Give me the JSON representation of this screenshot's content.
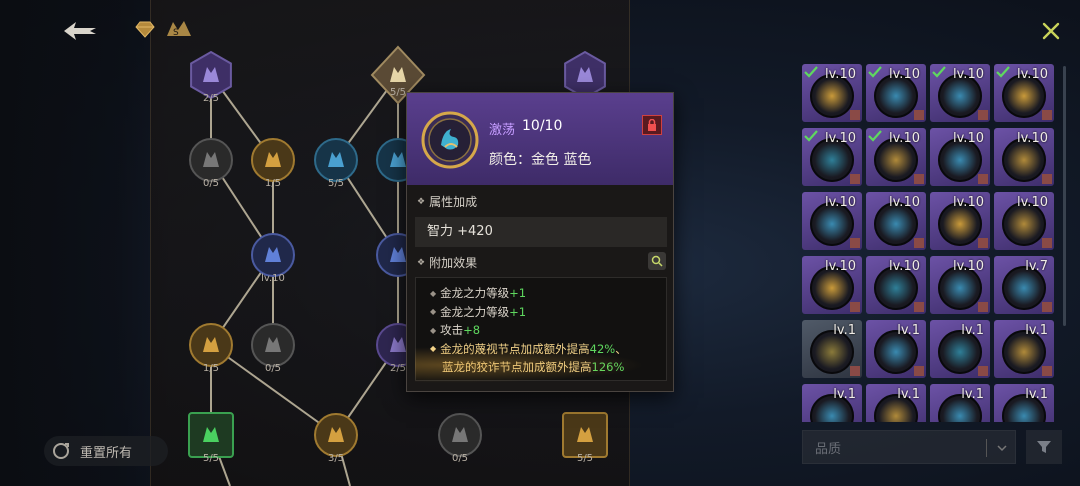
{
  "header": {
    "back_icon": "back-arrow-icon",
    "currency_icon": "gem-icon",
    "rank_icon": "rank-badge-icon",
    "close_icon": "close-icon"
  },
  "tree": {
    "nodes": [
      {
        "label": "2/5"
      },
      {
        "label": "5/5"
      },
      {
        "label": ""
      },
      {
        "label": "0/5"
      },
      {
        "label": "1/5"
      },
      {
        "label": "5/5"
      },
      {
        "label": ""
      },
      {
        "label": "lv.10"
      },
      {
        "label": ""
      },
      {
        "label": "1/5"
      },
      {
        "label": "0/5"
      },
      {
        "label": "2/5"
      },
      {
        "label": "5/5"
      },
      {
        "label": "3/5"
      },
      {
        "label": "0/5"
      },
      {
        "label": "5/5"
      }
    ]
  },
  "reset": {
    "label": "重置所有"
  },
  "tooltip": {
    "name": "激荡",
    "level": "10/10",
    "color_line": "颜色：金色 蓝色",
    "attr_title": "属性加成",
    "stat": "智力 +420",
    "effects_title": "附加效果",
    "effects": [
      {
        "text": "金龙之力等级",
        "value": "+1"
      },
      {
        "text": "金龙之力等级",
        "value": "+1"
      },
      {
        "text": "攻击",
        "value": "+8"
      }
    ],
    "special_line1_prefix": "金龙的蔑视节点加成额外提高",
    "special_line1_value": "42%",
    "special_line1_suffix": "、",
    "special_line2_prefix": "蓝龙的狡诈节点加成额外提高",
    "special_line2_value": "126%"
  },
  "inventory": {
    "slots": [
      {
        "lvl": "lv.10",
        "frame": "purple",
        "check": true,
        "orb": "#c99a3a"
      },
      {
        "lvl": "lv.10",
        "frame": "purple",
        "check": true,
        "orb": "#3a8ab0"
      },
      {
        "lvl": "lv.10",
        "frame": "purple",
        "check": true,
        "orb": "#3a8ab0"
      },
      {
        "lvl": "lv.10",
        "frame": "purple",
        "check": true,
        "orb": "#c99a3a"
      },
      {
        "lvl": "lv.10",
        "frame": "purple",
        "check": true,
        "orb": "#2f7f98"
      },
      {
        "lvl": "lv.10",
        "frame": "purple",
        "check": true,
        "orb": "#b08a3a"
      },
      {
        "lvl": "lv.10",
        "frame": "purple",
        "check": false,
        "orb": "#3a8ab0"
      },
      {
        "lvl": "lv.10",
        "frame": "purple",
        "check": false,
        "orb": "#b08a3a"
      },
      {
        "lvl": "lv.10",
        "frame": "purple",
        "check": false,
        "orb": "#3a8ab0"
      },
      {
        "lvl": "lv.10",
        "frame": "purple",
        "check": false,
        "orb": "#3a8ab0"
      },
      {
        "lvl": "lv.10",
        "frame": "purple",
        "check": false,
        "orb": "#c99a3a"
      },
      {
        "lvl": "lv.10",
        "frame": "purple",
        "check": false,
        "orb": "#b08a3a"
      },
      {
        "lvl": "lv.10",
        "frame": "purple",
        "check": false,
        "orb": "#c99a3a"
      },
      {
        "lvl": "lv.10",
        "frame": "purple",
        "check": false,
        "orb": "#2f7f98"
      },
      {
        "lvl": "lv.10",
        "frame": "purple",
        "check": false,
        "orb": "#3a8ab0"
      },
      {
        "lvl": "lv.7",
        "frame": "purple",
        "check": false,
        "orb": "#3a8ab0"
      },
      {
        "lvl": "lv.1",
        "frame": "gray",
        "check": false,
        "orb": "#8a7a3a"
      },
      {
        "lvl": "lv.1",
        "frame": "purple",
        "check": false,
        "orb": "#3a8ab0"
      },
      {
        "lvl": "lv.1",
        "frame": "purple",
        "check": false,
        "orb": "#2f7f98"
      },
      {
        "lvl": "lv.1",
        "frame": "purple",
        "check": false,
        "orb": "#b08a3a"
      },
      {
        "lvl": "lv.1",
        "frame": "purple",
        "check": false,
        "orb": "#3a8ab0"
      },
      {
        "lvl": "lv.1",
        "frame": "purple",
        "check": false,
        "orb": "#b08a3a"
      },
      {
        "lvl": "lv.1",
        "frame": "purple",
        "check": false,
        "orb": "#3a8ab0"
      },
      {
        "lvl": "lv.1",
        "frame": "purple",
        "check": false,
        "orb": "#3a8ab0"
      }
    ]
  },
  "filter": {
    "quality_placeholder": "品质",
    "filter_icon": "filter-funnel-icon"
  },
  "colors": {
    "accent_purple": "#5a3f8e",
    "gain_green": "#5fd85f",
    "gold": "#f3d38a"
  }
}
